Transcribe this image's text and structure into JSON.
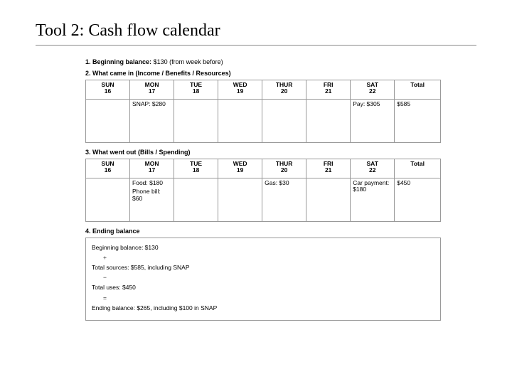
{
  "title": "Tool 2: Cash flow calendar",
  "section1": {
    "num": "1.",
    "label": "Beginning balance:",
    "text": "$130 (from week before)"
  },
  "section2": {
    "num": "2.",
    "label": "What came in (Income / Benefits / Resources)"
  },
  "section3": {
    "num": "3.",
    "label": "What went out (Bills / Spending)"
  },
  "section4": {
    "num": "4.",
    "label": "Ending balance"
  },
  "days": {
    "sun": "SUN",
    "mon": "MON",
    "tue": "TUE",
    "wed": "WED",
    "thur": "THUR",
    "fri": "FRI",
    "sat": "SAT",
    "total": "Total"
  },
  "dates": {
    "sun": "16",
    "mon": "17",
    "tue": "18",
    "wed": "19",
    "thur": "20",
    "fri": "21",
    "sat": "22"
  },
  "income": {
    "mon": "SNAP: $280",
    "sat": "Pay: $305",
    "total": "$585"
  },
  "expense": {
    "mon1": "Food: $180",
    "mon2": "Phone bill: $60",
    "thur": "Gas: $30",
    "sat": "Car payment: $180",
    "total": "$450"
  },
  "summary": {
    "r1": "Beginning balance: $130",
    "plus": "+",
    "r2": "Total sources: $585, including SNAP",
    "minus": "−",
    "r3": "Total uses: $450",
    "eq": "=",
    "r4": "Ending balance: $265, including $100 in SNAP"
  }
}
